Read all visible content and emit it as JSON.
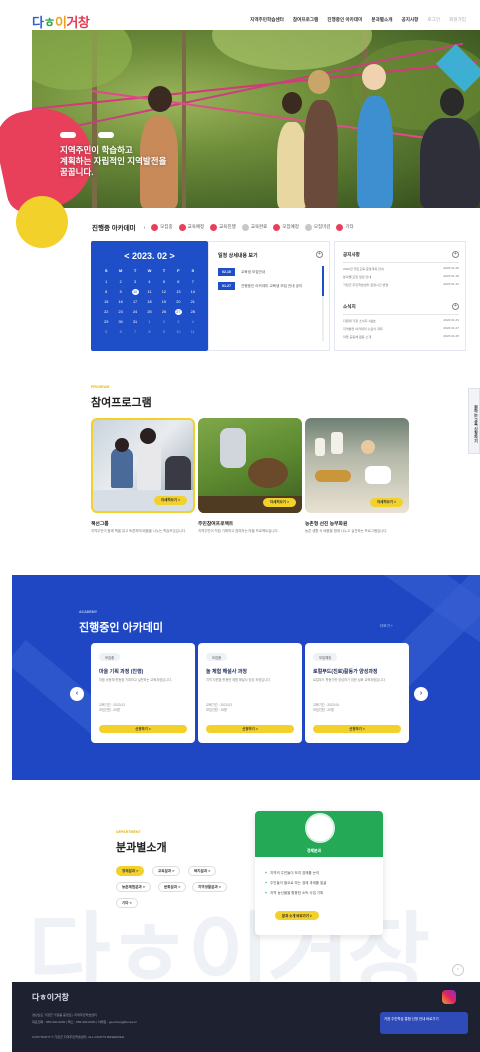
{
  "header": {
    "logo_parts": [
      "다",
      "ㅎ",
      "이",
      "거창"
    ],
    "nav": [
      "지역주민학습센터",
      "참여프로그램",
      "진행중인 아카데미",
      "분과별소개",
      "공지사항"
    ],
    "nav_muted": [
      "로그인",
      "회원가입"
    ]
  },
  "hero": {
    "copy_line1": "지역주민이 학습하고",
    "copy_line2": "계획하는 자립적인 지역발전을",
    "copy_line3": "꿈꿉니다."
  },
  "academy_bar": {
    "title": "진행중 아카데미",
    "chips": [
      {
        "label": "모집중",
        "color": "#e8405a"
      },
      {
        "label": "교육예정",
        "color": "#e8405a"
      },
      {
        "label": "교육진행",
        "color": "#e8405a"
      },
      {
        "label": "교육완료",
        "color": "#c8c8c8"
      },
      {
        "label": "모집예정",
        "color": "#e8405a"
      },
      {
        "label": "모집마감",
        "color": "#c8c8c8"
      },
      {
        "label": "기타",
        "color": "#e8405a"
      }
    ]
  },
  "calendar": {
    "title": "< 2023. 02 >",
    "dow": [
      "S",
      "M",
      "T",
      "W",
      "T",
      "F",
      "S"
    ],
    "days": [
      "1",
      "2",
      "3",
      "4",
      "5",
      "6",
      "7",
      "8",
      "9",
      "10",
      "11",
      "12",
      "13",
      "14",
      "15",
      "16",
      "17",
      "18",
      "19",
      "20",
      "21",
      "22",
      "23",
      "24",
      "25",
      "26",
      "27",
      "28",
      "29",
      "30",
      "31",
      "1",
      "2",
      "3",
      "4",
      "5",
      "6",
      "7",
      "8",
      "9",
      "10",
      "11"
    ],
    "selected": [
      "10",
      "27"
    ]
  },
  "schedule": {
    "title": "일정 상세내용 보기",
    "rows": [
      {
        "date": "02.10",
        "text": "교육생 모집안내"
      },
      {
        "date": "01.27",
        "text": "진행중인 아카데미 교육생 모집 안내 공지"
      }
    ]
  },
  "notices": {
    "title1": "공지사항",
    "rows1": [
      {
        "text": "2023년 주민교육 운영계획 안내",
        "date": "2023.01.20"
      },
      {
        "text": "분과별 모임 일정 안내",
        "date": "2023.01.18"
      },
      {
        "text": "거창군 주민학습센터 운영시간 변경",
        "date": "2023.01.12"
      }
    ],
    "title2": "소식지",
    "rows2": [
      {
        "text": "다함께 거창 소식지 1월호",
        "date": "2023.01.31"
      },
      {
        "text": "지역발전 아카데미 수료식 개최",
        "date": "2023.01.27"
      },
      {
        "text": "마을 공동체 활동 소개",
        "date": "2023.01.25"
      }
    ]
  },
  "programs": {
    "label": "PROGRAM",
    "title": "참여프로그램",
    "side_tab": "원하는 교육 신청하기",
    "cards": [
      {
        "title": "책선그룹",
        "desc": "지역주민이 함께 책을 읽고 토론하며 배움을 나누는 학습모임입니다.",
        "button": "자세히보기 >"
      },
      {
        "title": "주민참여프로젝트",
        "desc": "지역주민이 직접 기획하고 참여하는 마을 프로젝트입니다.",
        "button": "자세히보기 >"
      },
      {
        "title": "농촌형 선진 농부화원",
        "desc": "농촌 생활 속 배움을 함께 나누고 실천하는 프로그램입니다.",
        "button": "자세히보기 >"
      }
    ]
  },
  "academy": {
    "label": "ACADEMY",
    "title": "진행중인 아카데미",
    "more": "더보기 +",
    "cards": [
      {
        "tag": "모집중",
        "title": "마을 기획 과정 (진행)",
        "desc": "마을 공동체 활동을 기획하고 실천하는 교육과정입니다.",
        "meta1": "교육기간 : 2023.03",
        "meta2": "모집인원 : 20명",
        "button": "신청하기 >"
      },
      {
        "tag": "모집중",
        "title": "놀 체험 해설사 과정",
        "desc": "지역 자원을 활용한 체험 해설사 양성 과정입니다.",
        "meta1": "교육기간 : 2023.03",
        "meta2": "모집인원 : 15명",
        "button": "신청하기 >"
      },
      {
        "tag": "모집예정",
        "title": "로컬푸드(진로)활동가 양성과정",
        "desc": "로컬푸드 활동가를 양성하기 위한 심화 교육과정입니다.",
        "meta1": "교육기간 : 2023.04",
        "meta2": "모집인원 : 20명",
        "button": "신청하기 >"
      }
    ]
  },
  "departments": {
    "label": "DEPARTMENT",
    "title": "분과별소개",
    "chips": [
      "경제분과 >",
      "교육분과 >",
      "복지분과 >",
      "농촌체험분과 >",
      "문화분과 >",
      "지역생활분과 >",
      "기타 >"
    ],
    "card_badge": "경제분과",
    "card_rows": [
      "지역의 주민들이 모여 경제를 논의",
      "주민들이 필요로 하는 경제 과제를 발굴",
      "지역 농산물을 활용한 소득 사업 기획"
    ],
    "card_button": "분과 소개 바로가기 >",
    "watermark": "다ㅎ이거창",
    "top_button": "↑"
  },
  "footer": {
    "logo": "다ㅎ이거창",
    "line1": "경상남도 거창군 거창읍 중앙로 | 지역주민학습센터",
    "line2": "대표전화 : 055-940-0000 | 팩스 : 055-940-0000 | 이메일 : geochang@korea.kr",
    "line3": "COPYRIGHT © 거창군 지역주민학습센터. ALL RIGHTS RESERVED.",
    "banner": "거창 주민학습 통합 신청 안내 바로가기"
  }
}
